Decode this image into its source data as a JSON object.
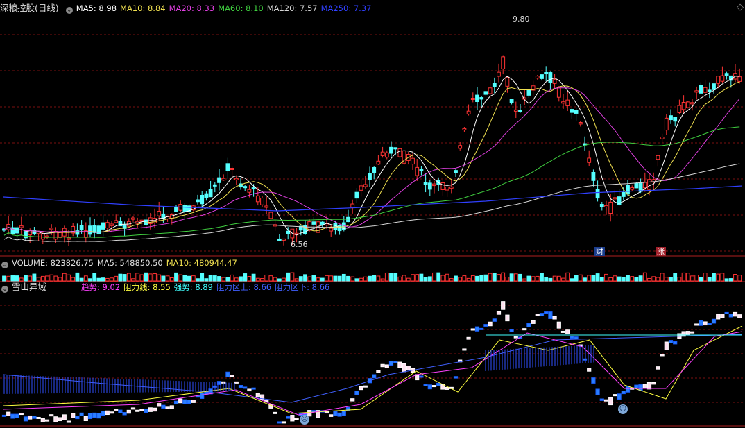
{
  "header": {
    "title": "深粮控股(日线)",
    "ma": [
      {
        "label": "MA5: 8.98",
        "color": "#ffffff"
      },
      {
        "label": "MA10: 8.84",
        "color": "#f0e050"
      },
      {
        "label": "MA20: 8.33",
        "color": "#e040e0"
      },
      {
        "label": "MA60: 8.10",
        "color": "#40d040"
      },
      {
        "label": "MA120: 7.57",
        "color": "#d8d8d8"
      },
      {
        "label": "MA250: 7.37",
        "color": "#3040ff"
      }
    ]
  },
  "price_chart": {
    "high_label": "9.80",
    "low_label": "6.56",
    "tag_cai": "财",
    "tag_zhang": "涨",
    "colors": {
      "up": "#ff3333",
      "down": "#54ffff",
      "grid": "#7a1010"
    }
  },
  "volume": {
    "label": "VOLUME: 823826.75",
    "ma5": "MA5: 548850.50",
    "ma10": "MA10: 480944.47"
  },
  "indicator": {
    "title": "雪山异域",
    "items": [
      {
        "label": "趋势: 9.02",
        "color": "#ff40ff"
      },
      {
        "label": "阻力线: 8.55",
        "color": "#ffff40"
      },
      {
        "label": "强势: 8.89",
        "color": "#40ffff"
      },
      {
        "label": "阻力区上: 8.66",
        "color": "#4060ff"
      },
      {
        "label": "阻力区下: 8.66",
        "color": "#4060ff"
      }
    ]
  },
  "icons": {
    "collapse": "collapse-circle-icon",
    "settings": "diamond-icon",
    "face": "sad-face-icon"
  }
}
